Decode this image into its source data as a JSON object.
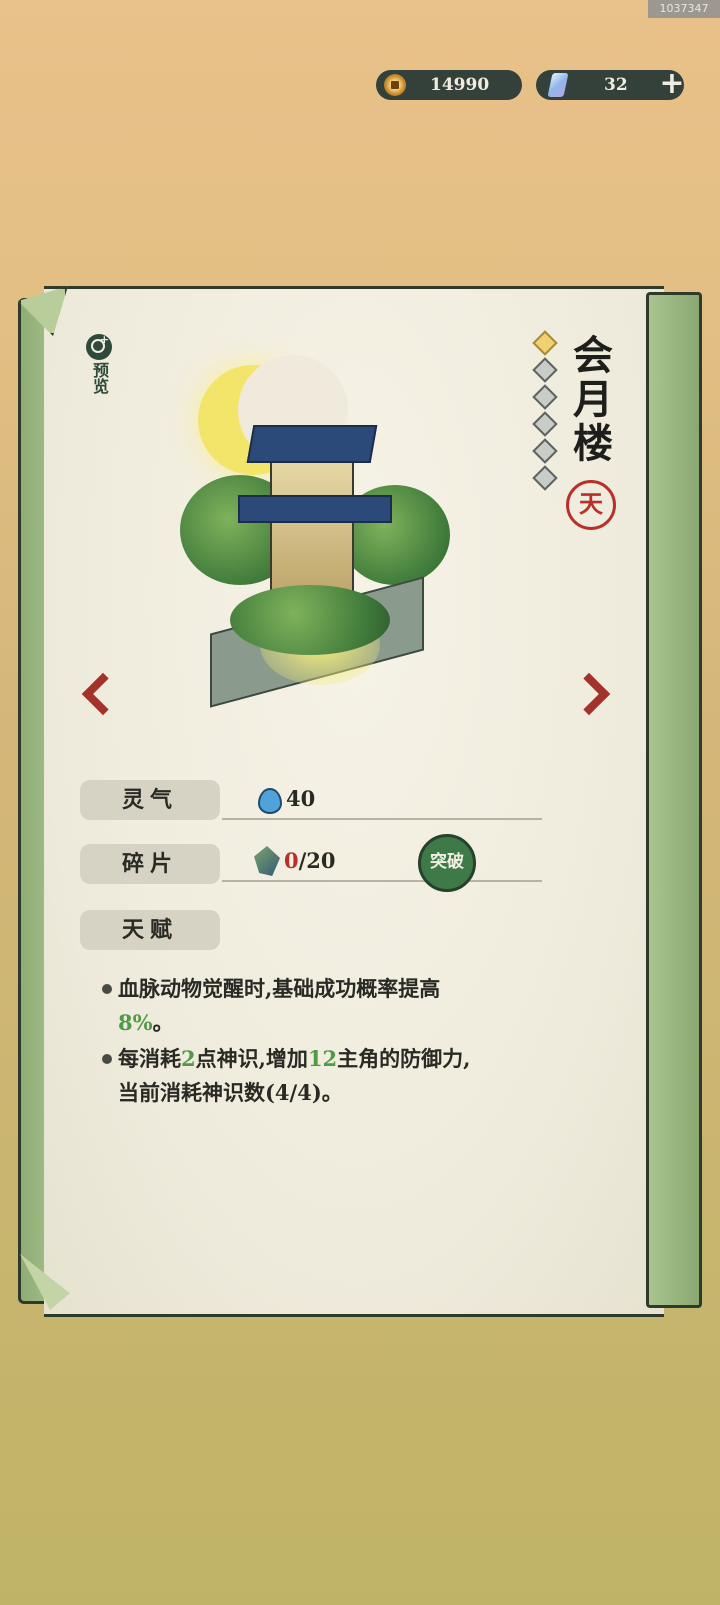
{
  "build_id": "1037347",
  "currency": {
    "coins": "14990",
    "gems": "32",
    "add_label": "+"
  },
  "preview": {
    "label": "预览"
  },
  "building": {
    "name": "会月楼",
    "seal_char": "天",
    "stars_total": 6,
    "stars_active": 1
  },
  "stats": {
    "lingqi_label": "灵气",
    "lingqi_value": "40",
    "fragment_label": "碎片",
    "fragment_current": "0",
    "fragment_total": "/20",
    "breakthrough_label": "突破",
    "talent_label": "天赋"
  },
  "talents": [
    {
      "line1": "血脉动物觉醒时,基础成功概率提高",
      "highlight": "8%",
      "tail": "。"
    },
    {
      "p1": "每消耗",
      "n1": "2",
      "p2": "点神识,增加",
      "n2": "12",
      "p3": "主角的防御力,",
      "p4": "当前消耗神识数",
      "n3": "(4/4)",
      "tail": "。"
    }
  ],
  "colors": {
    "accent_green": "#4f9a45",
    "accent_red": "#b8302a",
    "pill_bg": "#34413b"
  }
}
